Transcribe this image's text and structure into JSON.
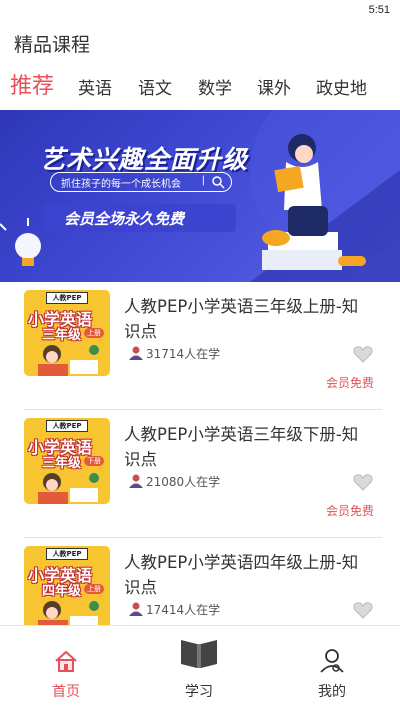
{
  "status_bar": {
    "time": "5:51"
  },
  "header": {
    "title": "精品课程"
  },
  "tabs": [
    {
      "label": "推荐",
      "active": true
    },
    {
      "label": "英语",
      "active": false
    },
    {
      "label": "语文",
      "active": false
    },
    {
      "label": "数学",
      "active": false
    },
    {
      "label": "课外",
      "active": false
    },
    {
      "label": "政史地",
      "active": false
    }
  ],
  "banner": {
    "headline": "艺术兴趣全面升级",
    "pill_text": "抓住孩子的每一个成长机会",
    "pill_sep": "|",
    "subheadline": "会员全场永久免费",
    "colors": {
      "background": "#3f49d3",
      "accent": "#f5a623"
    }
  },
  "courses": [
    {
      "title": "人教PEP小学英语三年级上册-知识点",
      "learners": "31714人在学",
      "tag": "会员免费",
      "cover": {
        "badge": "人教PEP",
        "line1": "小学英语",
        "line2": "三年级",
        "volume": "上册"
      }
    },
    {
      "title": "人教PEP小学英语三年级下册-知识点",
      "learners": "21080人在学",
      "tag": "会员免费",
      "cover": {
        "badge": "人教PEP",
        "line1": "小学英语",
        "line2": "三年级",
        "volume": "下册"
      }
    },
    {
      "title": "人教PEP小学英语四年级上册-知识点",
      "learners": "17414人在学",
      "tag": "",
      "cover": {
        "badge": "人教PEP",
        "line1": "小学英语",
        "line2": "四年级",
        "volume": "上册"
      }
    }
  ],
  "bottom_nav": [
    {
      "label": "首页",
      "icon": "home-icon",
      "active": true
    },
    {
      "label": "学习",
      "icon": "book-icon",
      "active": false
    },
    {
      "label": "我的",
      "icon": "profile-icon",
      "active": false
    }
  ],
  "colors": {
    "accent": "#e7505a",
    "text": "#333333",
    "cover": "#f7c531"
  }
}
